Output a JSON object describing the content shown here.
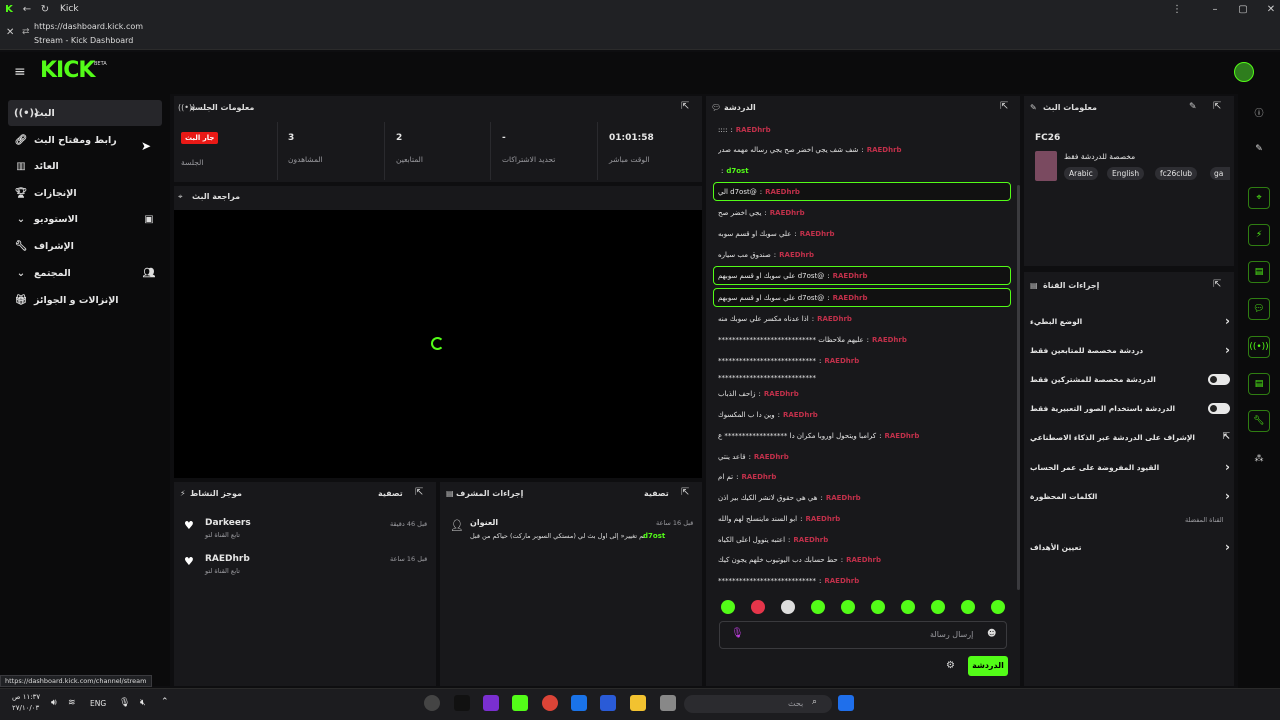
{
  "browser": {
    "tab_title": "Kick",
    "url": "https://dashboard.kick.com",
    "page_title": "Stream - Kick Dashboard",
    "status_url": "https://dashboard.kick.com/channel/stream"
  },
  "header": {
    "logo": "KICK",
    "beta": "BETA"
  },
  "nav": {
    "items": [
      {
        "label": "البث"
      },
      {
        "label": "رابط ومفتاح البث"
      },
      {
        "label": "العائد"
      },
      {
        "label": "الإنجازات"
      },
      {
        "label": "الاستوديو"
      },
      {
        "label": "الإشراف"
      },
      {
        "label": "المجتمع"
      },
      {
        "label": "الإنزالات و الجوائز"
      }
    ]
  },
  "session": {
    "title": "معلومات الجلسة",
    "live_badge": "جار البث",
    "session_label": "الجلسة",
    "viewers_value": "3",
    "viewers_label": "المشاهدون",
    "followers_value": "2",
    "followers_label": "المتابعين",
    "subs_value": "-",
    "subs_label": "تحديد الاشتراكات",
    "time_value": "01:01:58",
    "time_label": "الوقت مباشر"
  },
  "preview": {
    "title": "مراجعة البث"
  },
  "activity": {
    "title": "موجز النشاط",
    "filter": "تصفية",
    "items": [
      {
        "name": "Darkeers",
        "sub": "تابع القناة لتو",
        "time": "قبل 46 دقيقة"
      },
      {
        "name": "RAEDhrb",
        "sub": "تابع القناة لتو",
        "time": "قبل 16 ساعة"
      }
    ]
  },
  "modactions": {
    "title": "إجراءات المشرف",
    "filter": "تصفية",
    "item_title": "العنوان",
    "item_time": "قبل 16 ساعة",
    "item_user": "d7ost",
    "item_text": "تم تغيير« إلى اول بث لي (مستكي السوبر ماركت) حياكم من قبل"
  },
  "chat": {
    "title": "الدردشة",
    "lines": [
      {
        "user": "RAEDhrb",
        "text": "::::",
        "hl": false
      },
      {
        "user": "RAEDhrb",
        "text": "شف شف يجي اخضر صح يجي رساله مهمه صدر",
        "hl": false
      },
      {
        "user": "d7ost",
        "text": "",
        "hl": false
      },
      {
        "user": "RAEDhrb",
        "text": "@d7ost الي",
        "hl": true
      },
      {
        "user": "RAEDhrb",
        "text": "يجي اخضر صح",
        "hl": false
      },
      {
        "user": "RAEDhrb",
        "text": "علي سوبك او قسم سوبه",
        "hl": false
      },
      {
        "user": "RAEDhrb",
        "text": "صندوق مب سياره",
        "hl": false
      },
      {
        "user": "RAEDhrb",
        "text": "@d7ost علي سوبك او قسم سوبهم",
        "hl": true
      },
      {
        "user": "RAEDhrb",
        "text": "@d7ost علي سوبك او قسم سوبهم",
        "hl": true
      },
      {
        "user": "RAEDhrb",
        "text": "اذا عدناه مكسر علي سوبك منه",
        "hl": false
      },
      {
        "user": "RAEDhrb",
        "text": "عليهم ملاحظات ****************************",
        "hl": false
      },
      {
        "user": "RAEDhrb",
        "text": "****************************",
        "hl": false
      },
      {
        "user": "",
        "text": "****************************",
        "hl": false
      },
      {
        "user": "RAEDhrb",
        "text": "زاحف الذباب",
        "hl": false
      },
      {
        "user": "RAEDhrb",
        "text": "وين دا ب المكسوك",
        "hl": false
      },
      {
        "user": "RAEDhrb",
        "text": "كرامبا ويتحول اوروبا مكران دا ****************** ع",
        "hl": false
      },
      {
        "user": "RAEDhrb",
        "text": "قاعد ينتي",
        "hl": false
      },
      {
        "user": "RAEDhrb",
        "text": "تم ام",
        "hl": false
      },
      {
        "user": "RAEDhrb",
        "text": "هي هي حقوق لانشر الكيك بير اذن",
        "hl": false
      },
      {
        "user": "RAEDhrb",
        "text": "ابو السند ماينسلح لهم والله",
        "hl": false
      },
      {
        "user": "RAEDhrb",
        "text": "اعتبه يتوول اعلى الكياه",
        "hl": false
      },
      {
        "user": "RAEDhrb",
        "text": "حط حسابك دب اليوتيوب خلهم يجون كيك",
        "hl": false
      },
      {
        "user": "RAEDhrb",
        "text": "****************************",
        "hl": false
      }
    ],
    "placeholder": "إرسال رسالة",
    "send_label": "الدردشة"
  },
  "streaminfo": {
    "title": "معلومات البث",
    "stream_title": "FC26",
    "category": "مخصصة للدردشة فقط",
    "tags": [
      "Arabic",
      "English",
      "fc26club",
      "ga"
    ]
  },
  "channelactions": {
    "title": "إجراءات القناة",
    "rows": [
      {
        "label": "الوضع البطيء",
        "kind": "chevron"
      },
      {
        "label": "دردشة مخصصة للمتابعين فقط",
        "kind": "chevron"
      },
      {
        "label": "الدردشة مخصصة للمشتركين فقط",
        "kind": "toggle"
      },
      {
        "label": "الدردشة باستخدام الصور التعبيرية فقط",
        "kind": "toggle"
      },
      {
        "label": "الإشراف على الدردشة عبر الذكاء الاصطناعي",
        "kind": "external"
      },
      {
        "label": "القيود المفروضة على عمر الحساب",
        "kind": "chevron"
      },
      {
        "label": "الكلمات المحظورة",
        "kind": "chevron"
      }
    ],
    "section_label": "القناة المفضلة",
    "goals_label": "تعيين الأهداف"
  },
  "taskbar": {
    "time": "١١:٣٧ ص",
    "date": "٢٧/١٠/٠٣",
    "lang": "ENG",
    "search_placeholder": "بحث"
  },
  "colors": {
    "accent": "#53fc18",
    "panel": "#18181b",
    "bg": "#0e0e10",
    "user": "#c0304a",
    "live": "#e91916"
  }
}
